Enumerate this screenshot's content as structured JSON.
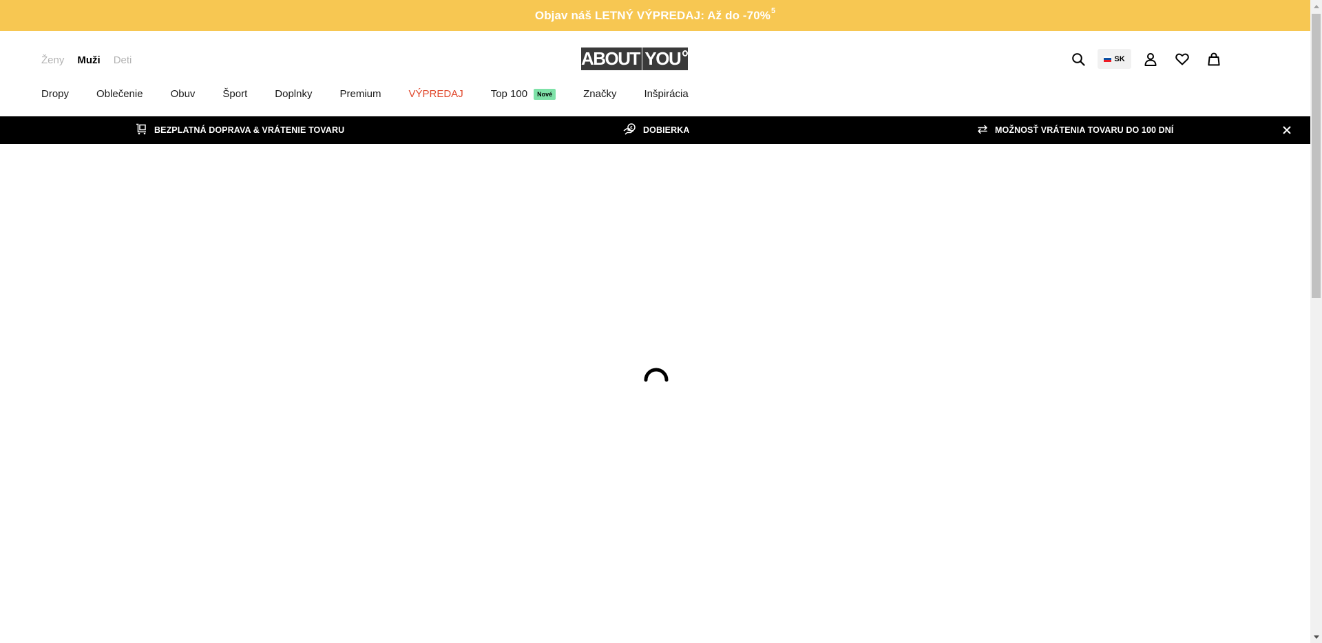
{
  "promo": {
    "text": "Objav náš LETNÝ VÝPREDAJ: Až do -70%",
    "superscript": "5",
    "bg_color": "#f7c752"
  },
  "header": {
    "gender_tabs": [
      {
        "label": "Ženy",
        "active": false
      },
      {
        "label": "Muži",
        "active": true
      },
      {
        "label": "Deti",
        "active": false
      }
    ],
    "logo": {
      "left": "ABOUT",
      "right": "YOU"
    },
    "language": {
      "code": "SK",
      "flag": "slovakia-flag-icon"
    },
    "icons": [
      "search-icon",
      "user-icon",
      "heart-icon",
      "bag-icon"
    ]
  },
  "nav": {
    "items": [
      {
        "label": "Dropy"
      },
      {
        "label": "Oblečenie"
      },
      {
        "label": "Obuv"
      },
      {
        "label": "Šport"
      },
      {
        "label": "Doplnky"
      },
      {
        "label": "Premium"
      },
      {
        "label": "VÝPREDAJ"
      },
      {
        "label": "Top 100",
        "badge": "Nové"
      },
      {
        "label": "Značky"
      },
      {
        "label": "Inšpirácia"
      }
    ],
    "sale_color": "#e0472b",
    "badge_color": "#7ee2a8"
  },
  "usp": {
    "items": [
      {
        "label": "BEZPLATNÁ DOPRAVA & VRÁTENIE TOVARU",
        "icon": "cart-icon"
      },
      {
        "label": "DOBIERKA",
        "icon": "coins-icon"
      },
      {
        "label": "MOŽNOSŤ VRÁTENIA TOVARU DO 100 DNÍ",
        "icon": "exchange-icon"
      }
    ],
    "close_icon": "close-icon"
  },
  "main": {
    "state": "loading",
    "spinner_icon": "loading-spinner-icon"
  }
}
